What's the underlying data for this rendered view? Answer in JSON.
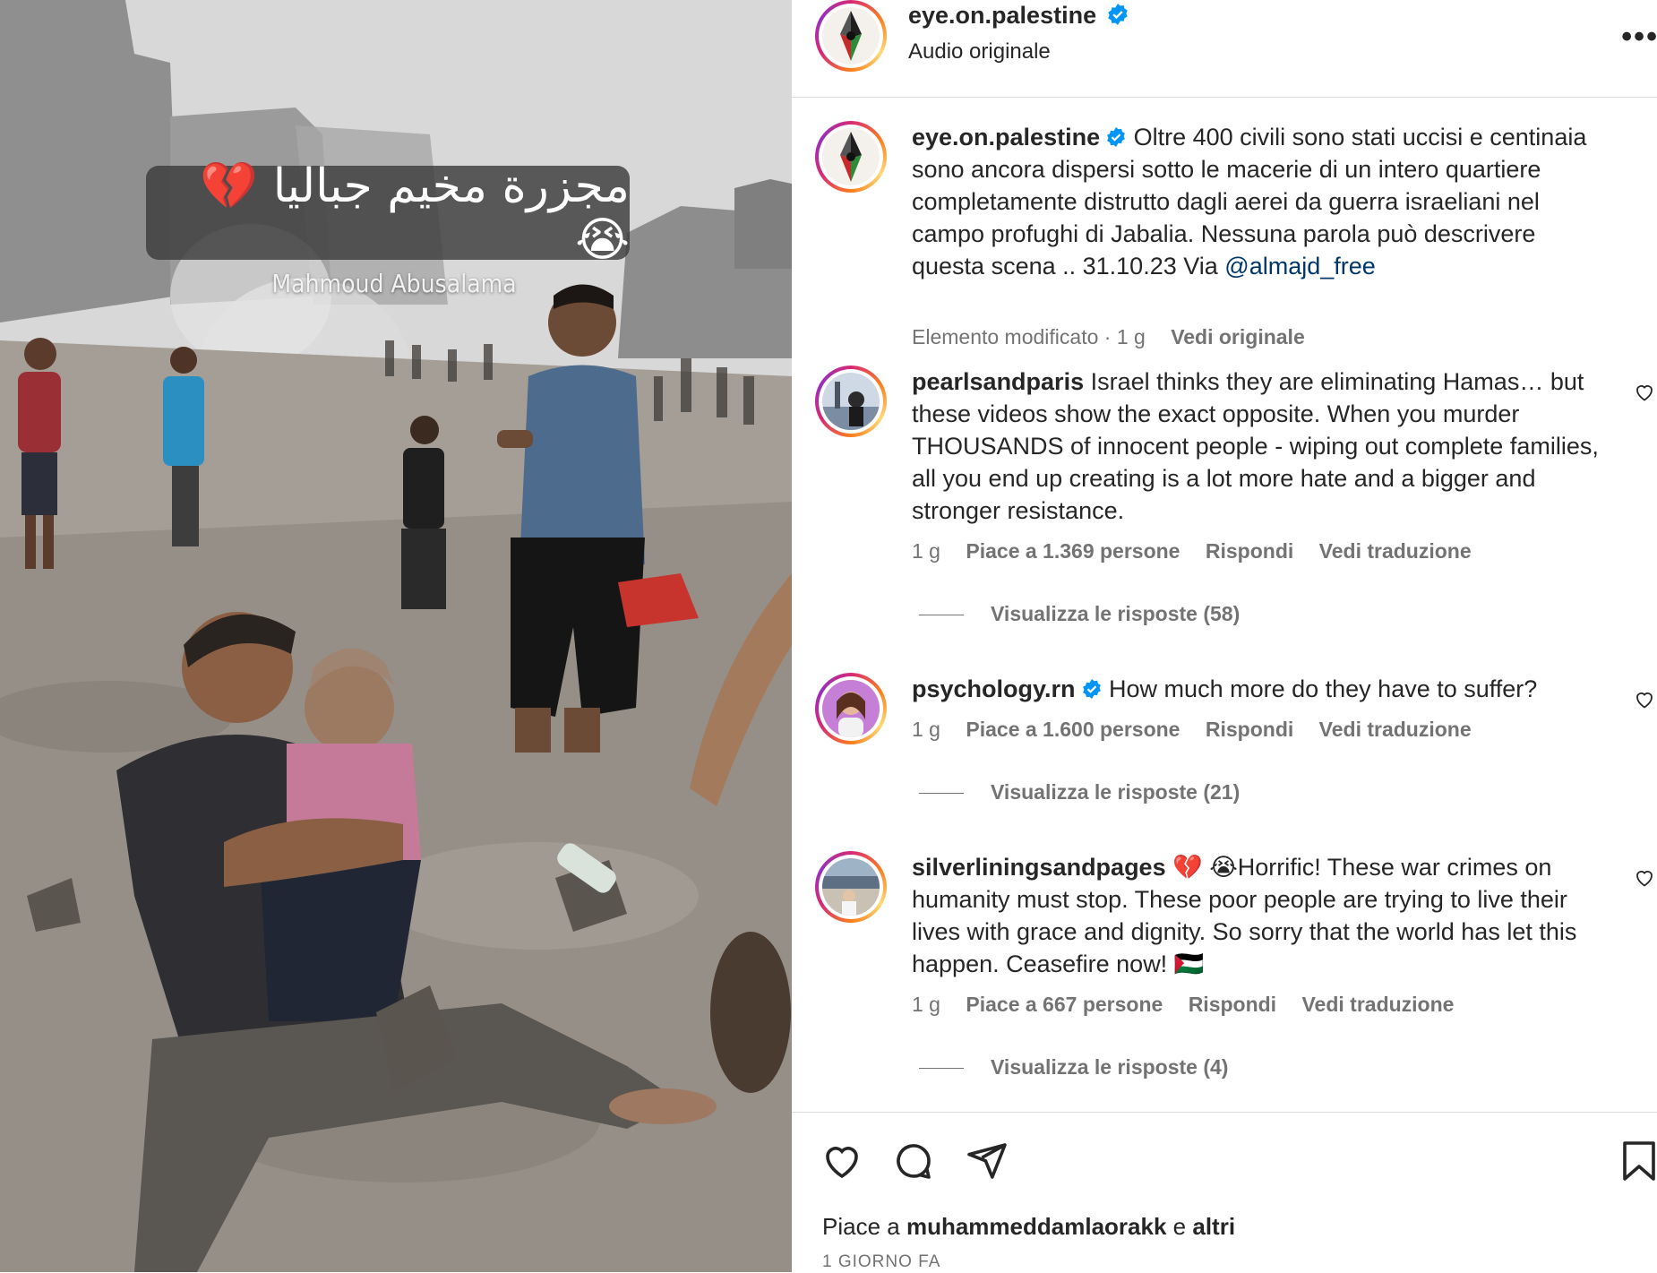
{
  "video": {
    "overlay_caption": "مجزرة مخيم جباليا 💔😭",
    "credit": "Mahmoud Abusalama"
  },
  "header": {
    "username": "eye.on.palestine",
    "audio": "Audio originale",
    "more_icon": "more-horizontal-icon"
  },
  "post": {
    "username": "eye.on.palestine",
    "caption": "Oltre 400 civili sono stati uccisi e centinaia sono ancora dispersi sotto le macerie di un intero quartiere completamente distrutto dagli aerei da guerra israeliani nel campo profughi di Jabalia. Nessuna parola può descrivere questa scena .. 31.10.23 Via",
    "mention": "@almajd_free",
    "edited": "Elemento modificato · 1 g",
    "see_original": "Vedi originale"
  },
  "comments": [
    {
      "username": "pearlsandparis",
      "text": "Israel thinks they are eliminating Hamas… but these videos show the exact opposite. When you murder THOUSANDS of innocent people - wiping out complete families, all you end up creating is a lot more hate and a bigger and stronger resistance.",
      "time": "1 g",
      "likes": "Piace a 1.369 persone",
      "reply": "Rispondi",
      "translate": "Vedi traduzione",
      "view_replies": "Visualizza le risposte (58)"
    },
    {
      "username": "psychology.rn",
      "text": "How much more do they have to suffer?",
      "time": "1 g",
      "likes": "Piace a 1.600 persone",
      "reply": "Rispondi",
      "translate": "Vedi traduzione",
      "view_replies": "Visualizza le risposte (21)"
    },
    {
      "username": "silverliningsandpages",
      "text": "💔 😭Horrific! These war crimes on humanity must stop. These poor people are trying to live their lives with grace and dignity. So sorry that the world has let this happen. Ceasefire now! 🇵🇸",
      "time": "1 g",
      "likes": "Piace a 667 persone",
      "reply": "Rispondi",
      "translate": "Vedi traduzione",
      "view_replies": "Visualizza le risposte (4)"
    }
  ],
  "footer": {
    "likes_prefix": "Piace a",
    "likes_user": "muhammeddamlaorakk",
    "likes_and": "e",
    "likes_others": "altri",
    "date": "1 GIORNO FA"
  },
  "icons": [
    "heart-icon",
    "comment-icon",
    "share-icon",
    "bookmark-icon",
    "verified-badge-icon"
  ],
  "colors": {
    "verified": "#0095f6",
    "link": "#00376b",
    "muted": "#737373"
  }
}
